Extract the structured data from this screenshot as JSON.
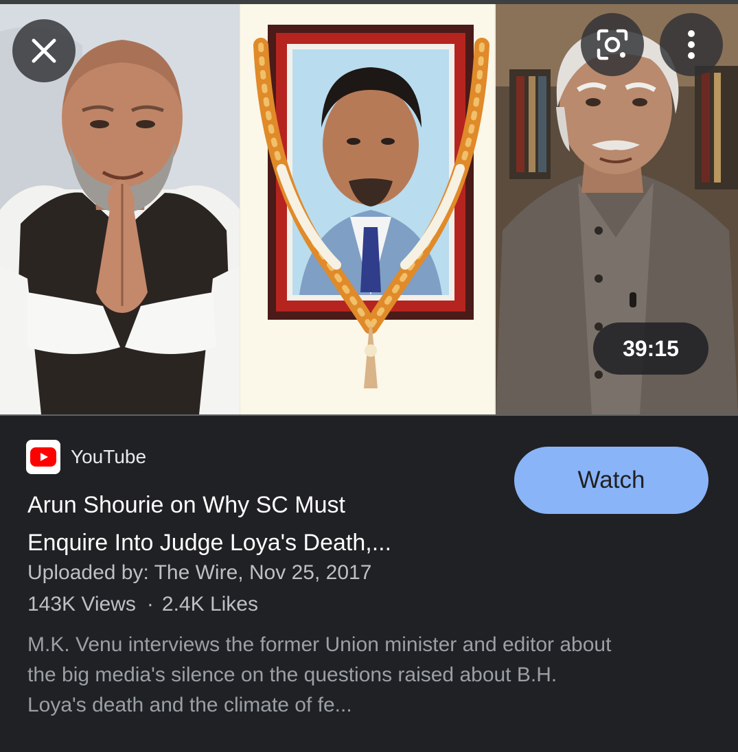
{
  "thumbnail": {
    "duration": "39:15"
  },
  "overlay_icons": {
    "close": "close-icon",
    "lens": "lens-search-icon",
    "more": "more-vert-icon"
  },
  "source": {
    "name": "YouTube",
    "icon": "youtube-icon",
    "brand_color": "#ff0000"
  },
  "video": {
    "title_line1": "Arun Shourie on Why SC Must",
    "title_line2": "Enquire Into Judge Loya's Death,...",
    "uploaded_by": "Uploaded by: The Wire, Nov 25, 2017",
    "views": "143K Views",
    "separator": "·",
    "likes": "2.4K Likes",
    "description_line1": "M.K. Venu interviews the former Union minister and editor about",
    "description_line2": "the big media's silence on the questions raised about B.H.",
    "description_line3": "Loya's death and the climate of fe..."
  },
  "actions": {
    "watch_label": "Watch"
  },
  "colors": {
    "background": "#202124",
    "accent": "#8ab4f8",
    "text_primary": "#ffffff",
    "text_secondary": "#bdc1c6",
    "text_muted": "#9aa0a6"
  }
}
